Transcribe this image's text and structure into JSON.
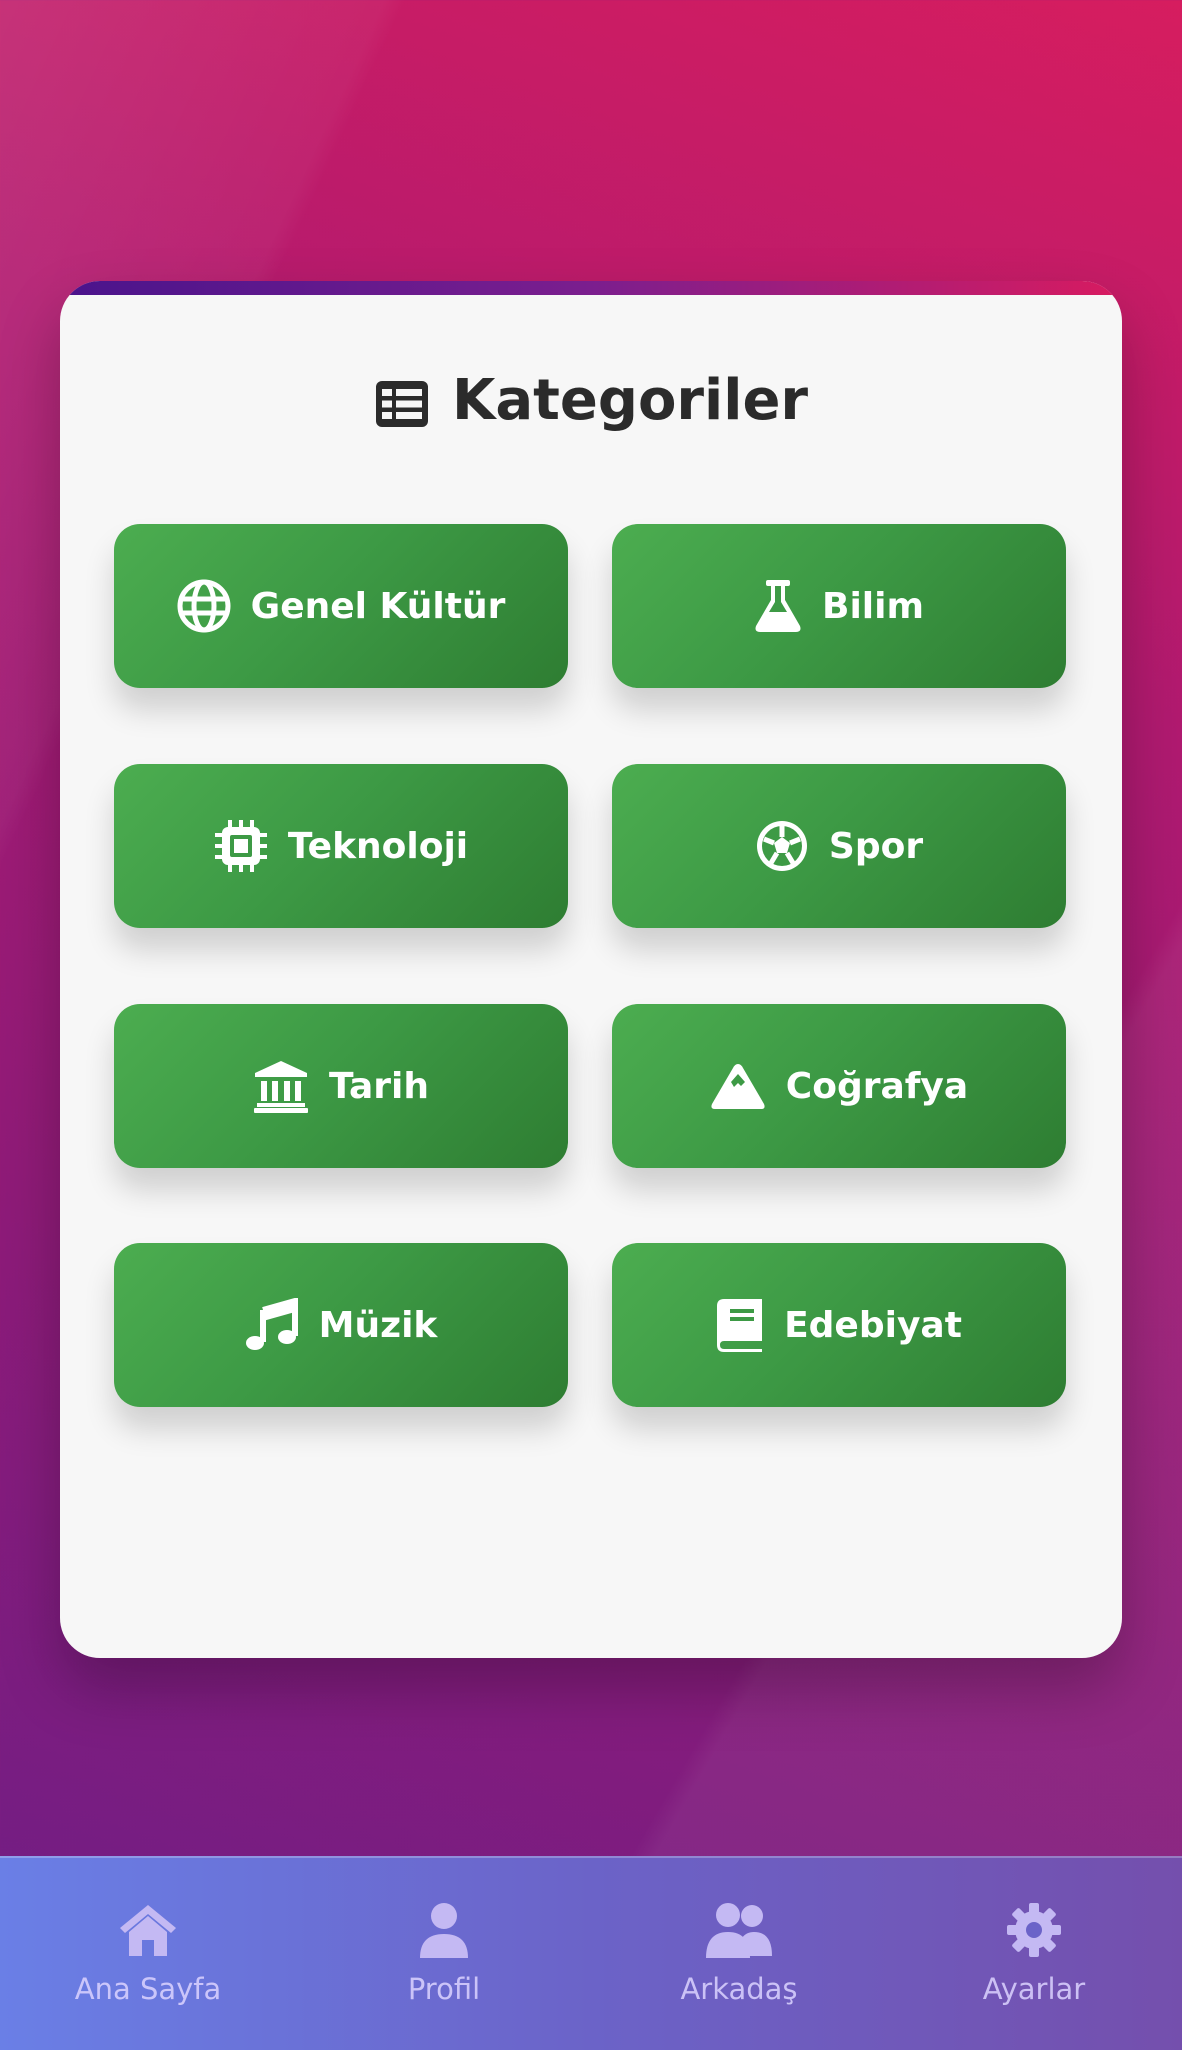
{
  "page": {
    "title": "Kategoriler",
    "title_icon": "list-table-icon"
  },
  "categories": [
    {
      "label": "Genel Kültür",
      "icon": "globe-icon"
    },
    {
      "label": "Bilim",
      "icon": "flask-icon"
    },
    {
      "label": "Teknoloji",
      "icon": "microchip-icon"
    },
    {
      "label": "Spor",
      "icon": "soccer-ball-icon"
    },
    {
      "label": "Tarih",
      "icon": "landmark-icon"
    },
    {
      "label": "Coğrafya",
      "icon": "mountain-icon"
    },
    {
      "label": "Müzik",
      "icon": "music-note-icon"
    },
    {
      "label": "Edebiyat",
      "icon": "book-icon"
    }
  ],
  "nav": {
    "items": [
      {
        "label": "Ana Sayfa",
        "icon": "home-icon"
      },
      {
        "label": "Profil",
        "icon": "user-icon"
      },
      {
        "label": "Arkadaş",
        "icon": "users-icon"
      },
      {
        "label": "Ayarlar",
        "icon": "gear-icon"
      }
    ]
  },
  "colors": {
    "button_green_start": "#4cad50",
    "button_green_end": "#2e7d32",
    "card_bg": "#f7f7f7",
    "title_text": "#2b2b2b",
    "nav_gradient_start": "#6a7fe6",
    "nav_gradient_end": "#744fad",
    "background_top": "#d61d5f",
    "background_bottom": "#6d1e86"
  }
}
